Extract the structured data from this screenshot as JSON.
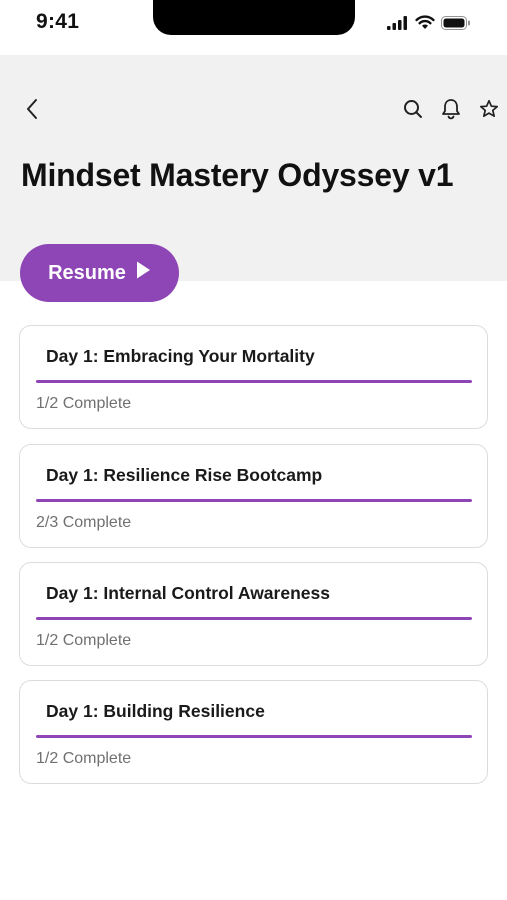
{
  "status_bar": {
    "time": "9:41"
  },
  "header": {
    "title": "Mindset Mastery Odyssey v1",
    "actions": [
      "search-icon",
      "bell-icon",
      "star-icon"
    ]
  },
  "resume": {
    "label": "Resume"
  },
  "colors": {
    "accent": "#8e45b5",
    "header_bg": "#f1f1f1",
    "card_border": "#dcdcdc",
    "muted_text": "#707070"
  },
  "lessons": [
    {
      "title": "Day 1: Embracing Your Mortality",
      "status": "1/2 Complete"
    },
    {
      "title": "Day 1: Resilience Rise Bootcamp",
      "status": "2/3 Complete"
    },
    {
      "title": "Day 1: Internal Control Awareness",
      "status": "1/2 Complete"
    },
    {
      "title": "Day 1: Building Resilience",
      "status": "1/2 Complete"
    }
  ]
}
